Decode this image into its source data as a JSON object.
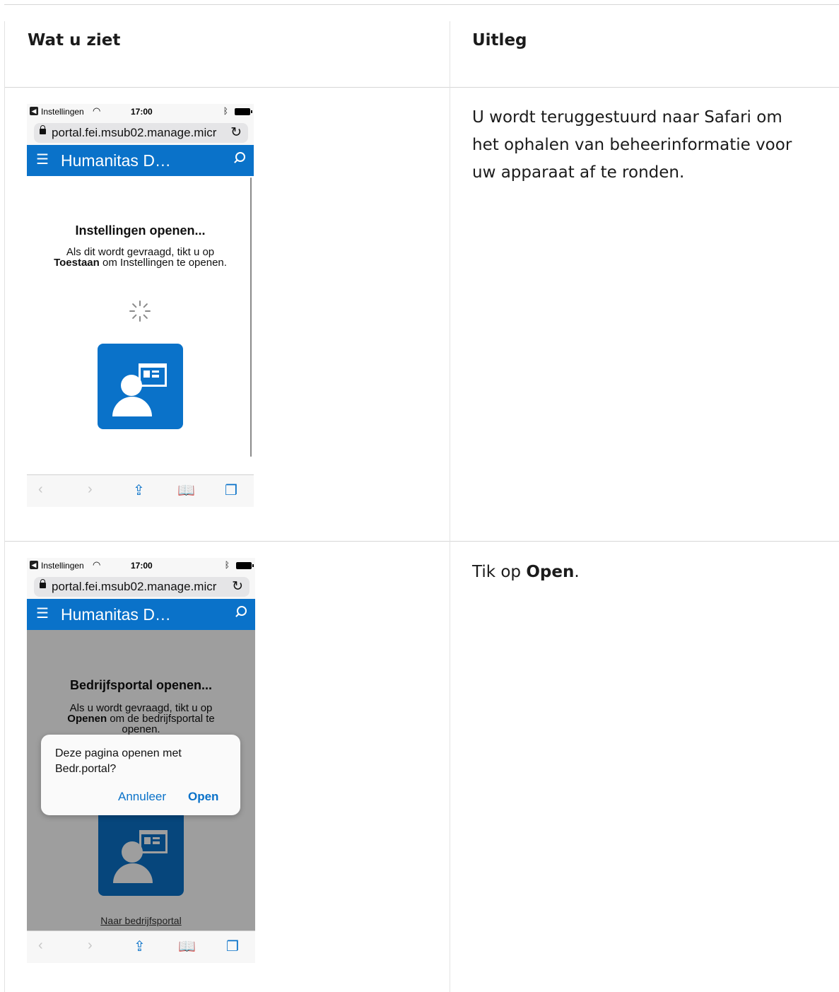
{
  "table": {
    "col1_header": "Wat u ziet",
    "col2_header": "Uitleg"
  },
  "rows": [
    {
      "explanation": "U wordt teruggestuurd naar Safari om het ophalen van beheerinformatie voor uw apparaat af te ronden.",
      "screenshot": {
        "status_app": "Instellingen",
        "status_time": "17:00",
        "url": "portal.fei.msub02.manage.micr",
        "brand": "Humanitas D…",
        "heading": "Instellingen openen...",
        "body_line1": "Als dit wordt gevraagd, tikt u op",
        "body_bold": "Toestaan",
        "body_line2_rest": " om Instellingen te openen."
      }
    },
    {
      "explanation_prefix": "Tik op ",
      "explanation_bold": "Open",
      "explanation_suffix": ".",
      "screenshot": {
        "status_app": "Instellingen",
        "status_time": "17:00",
        "url": "portal.fei.msub02.manage.micr",
        "brand": "Humanitas D…",
        "heading": "Bedrijfsportal openen...",
        "body_line1": "Als u wordt gevraagd, tikt u op",
        "body_bold": "Openen",
        "body_line2_rest": " om de bedrijfsportal te",
        "body_line3": "openen.",
        "dialog_message": "Deze pagina openen met Bedr.portal?",
        "dialog_cancel": "Annuleer",
        "dialog_open": "Open",
        "footer_link": "Naar bedrijfsportal"
      }
    }
  ],
  "colors": {
    "accent": "#0a72c9",
    "text": "#1b1b1b",
    "rule": "#d6d6d6"
  },
  "icons": [
    "back-app-icon",
    "wifi-icon",
    "bluetooth-icon",
    "battery-icon",
    "lock-icon",
    "reload-icon",
    "hamburger-menu-icon",
    "search-icon",
    "spinner-icon",
    "company-portal-icon",
    "back-arrow-icon",
    "forward-arrow-icon",
    "share-icon",
    "bookmarks-icon",
    "tabs-icon"
  ]
}
